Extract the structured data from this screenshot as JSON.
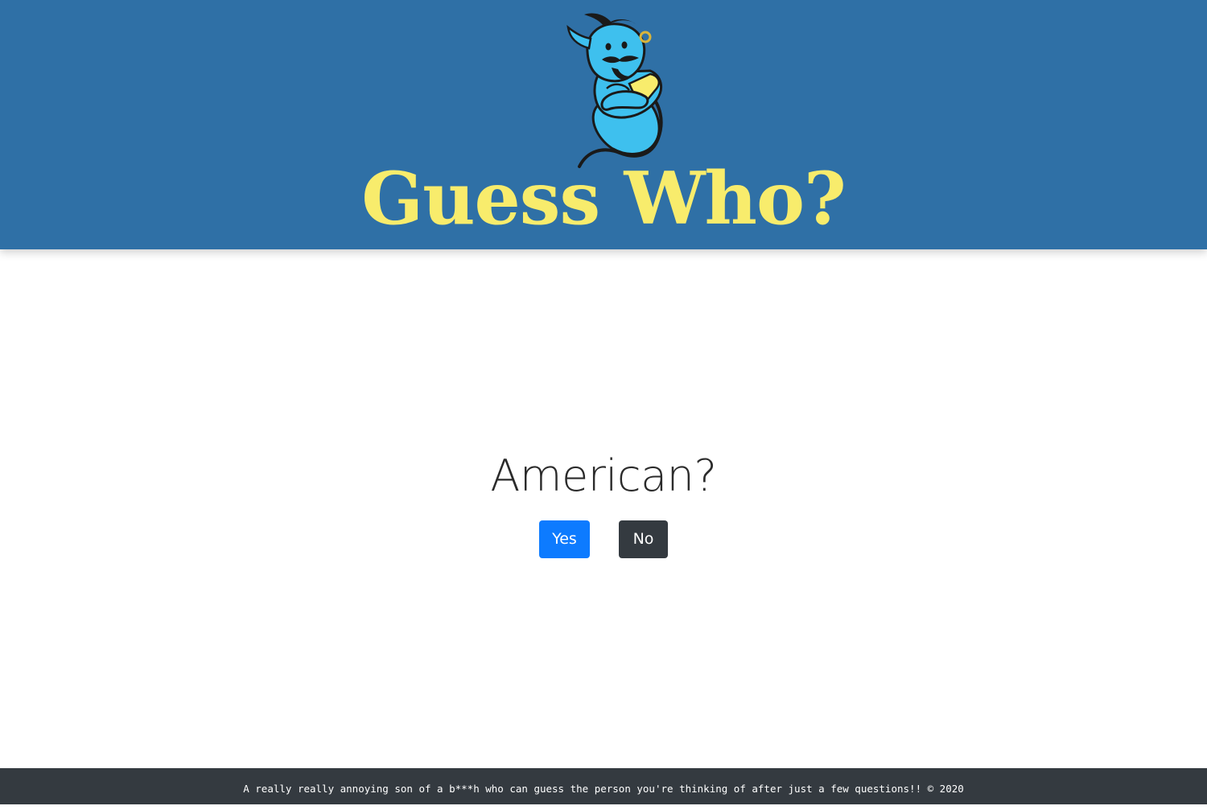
{
  "header": {
    "logo_icon": "genie-mascot-icon",
    "title": "Guess Who?"
  },
  "main": {
    "question": "American?",
    "yes_label": "Yes",
    "no_label": "No"
  },
  "footer": {
    "text": "A really really annoying son of a b***h who can guess the person you're thinking of after just a few questions!! © 2020"
  },
  "colors": {
    "header_bg": "#2f70a6",
    "title": "#f8ec6c",
    "yes_button": "#0d7bff",
    "no_button": "#343a40",
    "footer_bg": "#343a40",
    "genie_body": "#3ec0ee",
    "genie_outline": "#1a1a1a",
    "genie_vest": "#f8ec6c"
  }
}
